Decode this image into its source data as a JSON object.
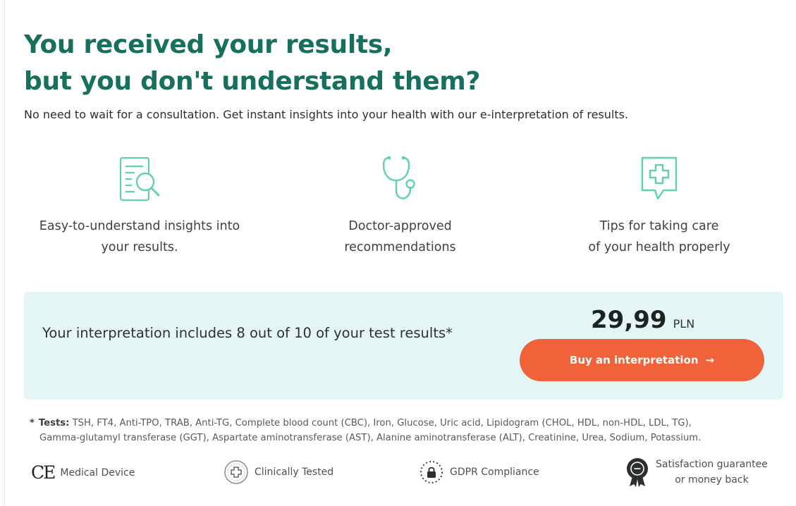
{
  "headline": {
    "line1": "You received your results,",
    "line2": "but you don't understand them?"
  },
  "subtitle": "No need to wait for a consultation. Get instant insights into your health with our e-interpretation of results.",
  "features": [
    {
      "icon": "document-search-icon",
      "line1": "Easy-to-understand insights into",
      "line2": "your results."
    },
    {
      "icon": "stethoscope-icon",
      "line1": "Doctor-approved",
      "line2": "recommendations"
    },
    {
      "icon": "medical-cross-chat-icon",
      "line1": "Tips for taking care",
      "line2": "of your health properly"
    }
  ],
  "offer": {
    "description": "Your interpretation includes 8 out of 10 of your test results*",
    "price": "29,99",
    "currency": "PLN",
    "button_label": "Buy an interpretation",
    "button_arrow": "→"
  },
  "tests": {
    "bullet": "*",
    "label": "Tests:",
    "line1": "TSH, FT4, Anti-TPO, TRAB, Anti-TG, Complete blood count (CBC), Iron, Glucose, Uric acid, Lipidogram (CHOL, HDL, non-HDL, LDL, TG),",
    "line2": "Gamma-glutamyl transferase (GGT), Aspartate aminotransferase (AST), Alanine aminotransferase (ALT), Creatinine, Urea, Sodium, Potassium."
  },
  "badges": {
    "medical_device": {
      "mark": "CE",
      "label": "Medical Device"
    },
    "clinically_tested": {
      "label": "Clinically Tested"
    },
    "gdpr": {
      "label": "GDPR Compliance"
    },
    "guarantee": {
      "line1": "Satisfaction guarantee",
      "line2": "or money back"
    }
  },
  "colors": {
    "heading": "#17705e",
    "icon_accent": "#5fd3a6",
    "panel_bg": "#e3f6f5",
    "button": "#f0633a"
  }
}
